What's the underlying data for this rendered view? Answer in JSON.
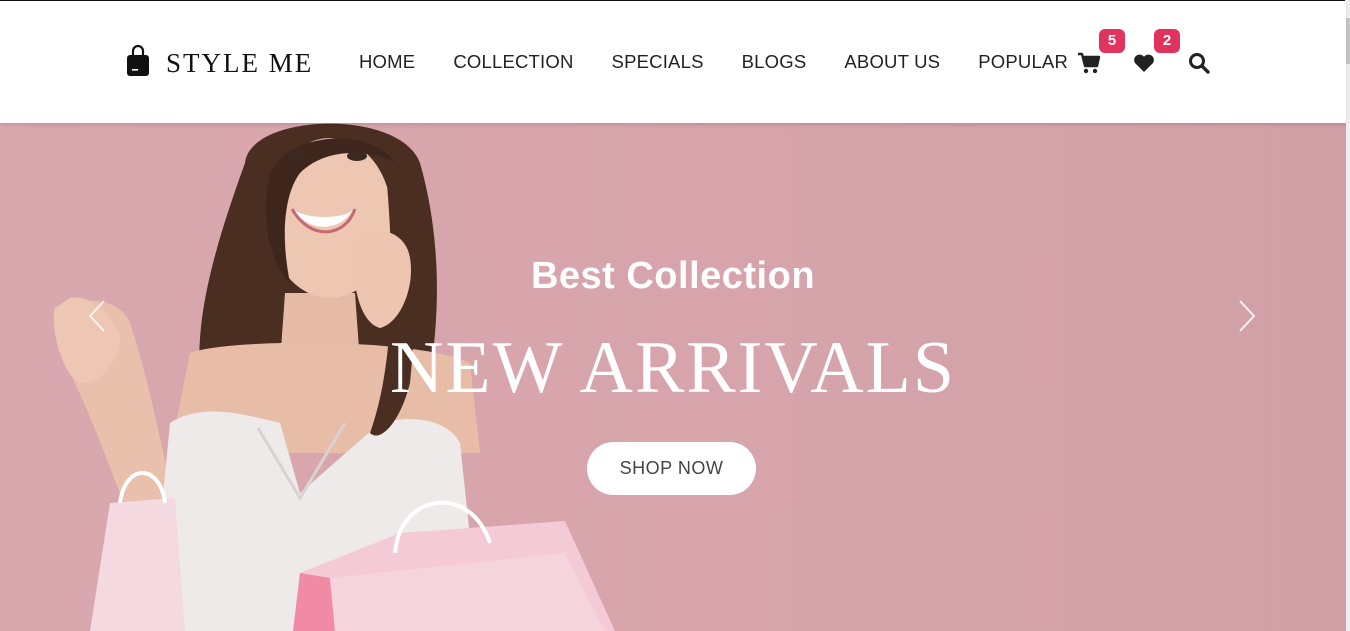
{
  "brand": {
    "name": "STYLE ME",
    "icon": "shopping-bag-icon"
  },
  "nav": {
    "items": [
      "HOME",
      "COLLECTION",
      "SPECIALS",
      "BLOGS",
      "ABOUT US",
      "POPULAR"
    ]
  },
  "header_icons": {
    "cart": {
      "icon": "cart-icon",
      "badge": "5"
    },
    "wishlist": {
      "icon": "heart-icon",
      "badge": "2"
    },
    "search": {
      "icon": "search-icon"
    }
  },
  "hero": {
    "subtitle": "Best Collection",
    "title": "NEW ARRIVALS",
    "cta": "SHOP NOW",
    "prev_icon": "chevron-left-icon",
    "next_icon": "chevron-right-icon"
  },
  "colors": {
    "hero_background": "#d8a8ae",
    "badge": "#e0335d",
    "text_dark": "#222222",
    "white": "#ffffff"
  }
}
